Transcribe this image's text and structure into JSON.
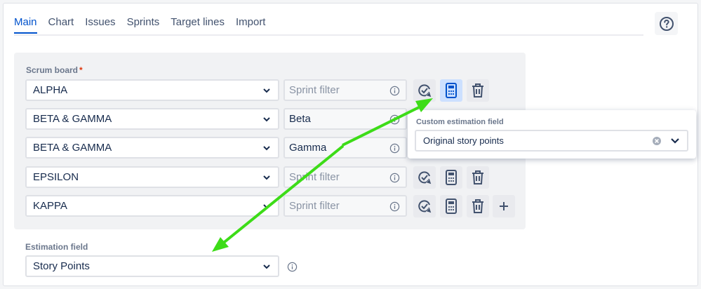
{
  "tabs": [
    "Main",
    "Chart",
    "Issues",
    "Sprints",
    "Target lines",
    "Import"
  ],
  "scrum": {
    "label": "Scrum board",
    "required": "*",
    "rows": [
      {
        "board": "ALPHA",
        "filter": "Sprint filter",
        "placeholder": true
      },
      {
        "board": "BETA & GAMMA",
        "filter": "Beta",
        "placeholder": false
      },
      {
        "board": "BETA & GAMMA",
        "filter": "Gamma",
        "placeholder": false
      },
      {
        "board": "EPSILON",
        "filter": "Sprint filter",
        "placeholder": true
      },
      {
        "board": "KAPPA",
        "filter": "Sprint filter",
        "placeholder": true
      }
    ],
    "add_symbol": "+"
  },
  "popup": {
    "label": "Custom estimation field",
    "value": "Original story points"
  },
  "estimation": {
    "label": "Estimation field",
    "value": "Story Points"
  },
  "colors": {
    "accent": "#0052cc",
    "arrow": "#3ddc18",
    "selected_button": "#cce0ff"
  },
  "icons": [
    "help-icon",
    "chevron-down-icon",
    "info-icon",
    "check-refresh-icon",
    "calculator-icon",
    "trash-icon",
    "plus-icon",
    "clear-icon"
  ]
}
